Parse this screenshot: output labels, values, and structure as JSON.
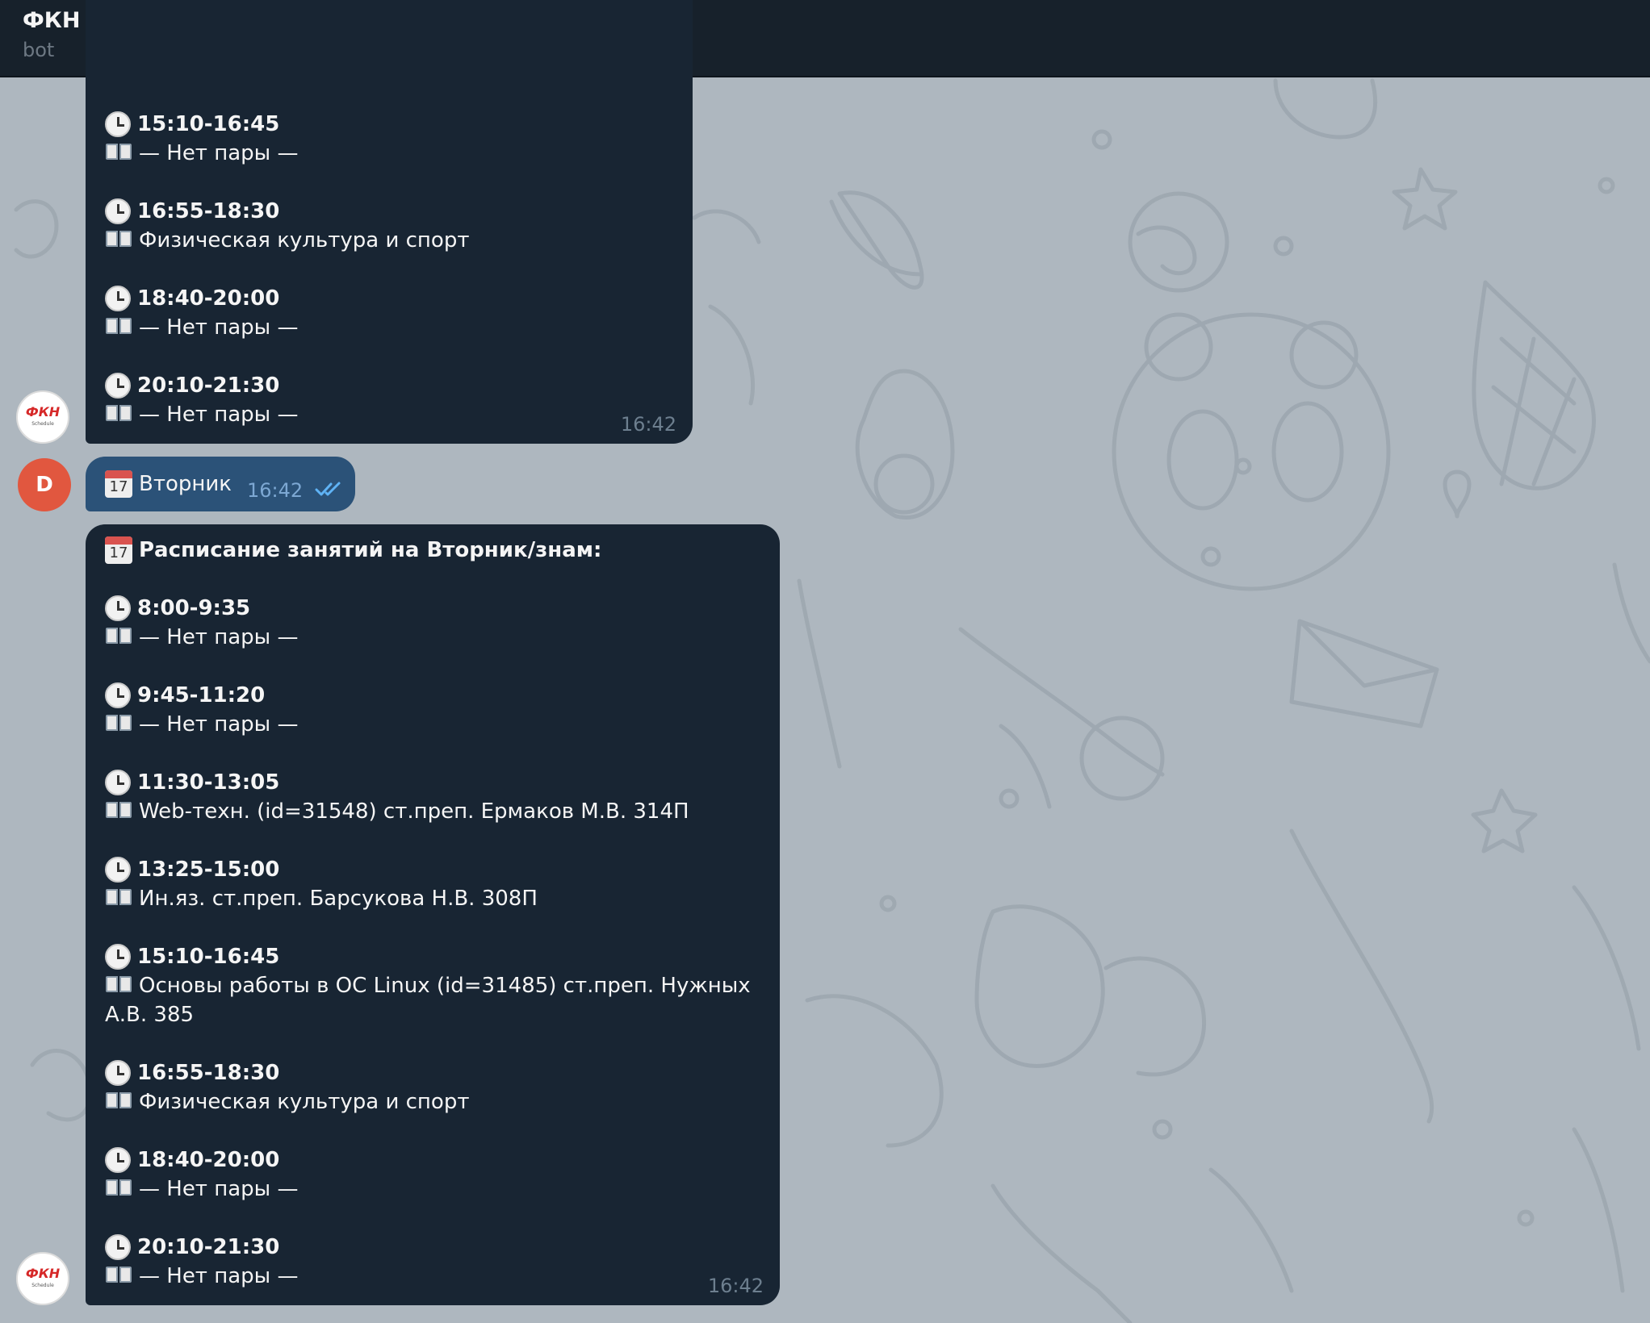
{
  "header": {
    "title": "ФКН Расписание",
    "calendar_day": "17",
    "subtitle": "bot"
  },
  "bot_avatar": {
    "logo_text": "ФКН",
    "logo_subtext": "Schedule"
  },
  "user_avatar": {
    "initial": "D"
  },
  "message1": {
    "slots": [
      {
        "time": "15:10-16:45",
        "subject": "— Нет пары —"
      },
      {
        "time": "16:55-18:30",
        "subject": "Физическая культура и спорт"
      },
      {
        "time": "18:40-20:00",
        "subject": "— Нет пары —"
      },
      {
        "time": "20:10-21:30",
        "subject": "— Нет пары —"
      }
    ],
    "time": "16:42"
  },
  "message2": {
    "calendar_day": "17",
    "text": "Вторник",
    "time": "16:42"
  },
  "message3": {
    "calendar_day": "17",
    "heading": "Расписание занятий на Вторник/знам:",
    "slots": [
      {
        "time": "8:00-9:35",
        "subject": "— Нет пары —"
      },
      {
        "time": "9:45-11:20",
        "subject": "— Нет пары —"
      },
      {
        "time": "11:30-13:05",
        "subject": "Web-техн. (id=31548) ст.преп. Ермаков М.В. 314П"
      },
      {
        "time": "13:25-15:00",
        "subject": "Ин.яз. ст.преп. Барсукова Н.В.  308П"
      },
      {
        "time": "15:10-16:45",
        "subject": "Основы работы в ОС Linux (id=31485) ст.преп. Нужных А.В. 385"
      },
      {
        "time": "16:55-18:30",
        "subject": "Физическая культура и спорт"
      },
      {
        "time": "18:40-20:00",
        "subject": "— Нет пары —"
      },
      {
        "time": "20:10-21:30",
        "subject": "— Нет пары —"
      }
    ],
    "time": "16:42"
  },
  "icons": {
    "clock": "clock-icon",
    "book": "open-book-icon",
    "calendar": "calendar-icon",
    "read_receipt": "double-check-icon"
  },
  "colors": {
    "header_bg": "#17212b",
    "incoming_bubble": "#182533",
    "outgoing_bubble": "#2b5278",
    "chat_bg": "#aeb7bf",
    "user_avatar": "#e1573f",
    "read_tick": "#5fb3f5"
  }
}
